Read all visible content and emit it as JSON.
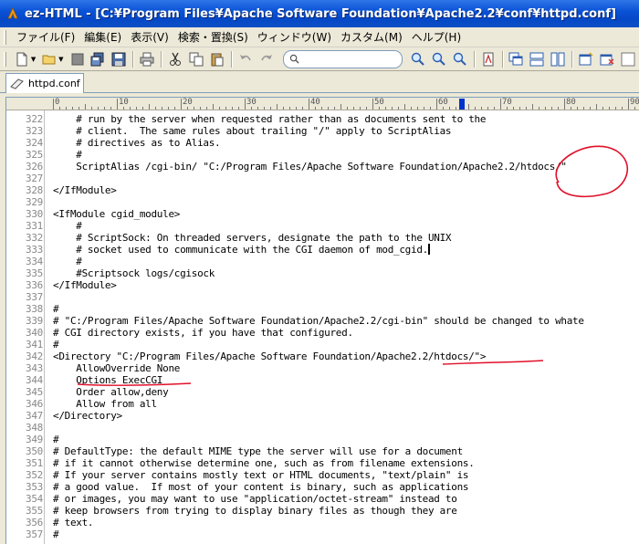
{
  "window": {
    "title": "ez-HTML - [C:¥Program Files¥Apache Software Foundation¥Apache2.2¥conf¥httpd.conf]"
  },
  "menu": [
    {
      "label": "ファイル(F)"
    },
    {
      "label": "編集(E)"
    },
    {
      "label": "表示(V)"
    },
    {
      "label": "検索・置換(S)"
    },
    {
      "label": "ウィンドウ(W)"
    },
    {
      "label": "カスタム(M)"
    },
    {
      "label": "ヘルプ(H)"
    }
  ],
  "toolbar": {
    "search_value": ""
  },
  "tabs": [
    {
      "label": "httpd.conf",
      "icon": "file-icon"
    }
  ],
  "ruler": {
    "labels": [
      "0",
      "10",
      "20",
      "30",
      "40",
      "50",
      "60",
      "70",
      "80",
      "90"
    ]
  },
  "editor": {
    "lines": [
      {
        "num": "322",
        "text": "    # run by the server when requested rather than as documents sent to the"
      },
      {
        "num": "323",
        "text": "    # client.  The same rules about trailing \"/\" apply to ScriptAlias"
      },
      {
        "num": "324",
        "text": "    # directives as to Alias."
      },
      {
        "num": "325",
        "text": "    #"
      },
      {
        "num": "326",
        "text": "    ScriptAlias /cgi-bin/ \"C:/Program Files/Apache Software Foundation/Apache2.2/htdocs/\""
      },
      {
        "num": "327",
        "text": ""
      },
      {
        "num": "328",
        "text": "</IfModule>"
      },
      {
        "num": "329",
        "text": ""
      },
      {
        "num": "330",
        "text": "<IfModule cgid_module>"
      },
      {
        "num": "331",
        "text": "    #"
      },
      {
        "num": "332",
        "text": "    # ScriptSock: On threaded servers, designate the path to the UNIX"
      },
      {
        "num": "333",
        "text": "    # socket used to communicate with the CGI daemon of mod_cgid."
      },
      {
        "num": "334",
        "text": "    #"
      },
      {
        "num": "335",
        "text": "    #Scriptsock logs/cgisock"
      },
      {
        "num": "336",
        "text": "</IfModule>"
      },
      {
        "num": "337",
        "text": ""
      },
      {
        "num": "338",
        "text": "#"
      },
      {
        "num": "339",
        "text": "# \"C:/Program Files/Apache Software Foundation/Apache2.2/cgi-bin\" should be changed to whate"
      },
      {
        "num": "340",
        "text": "# CGI directory exists, if you have that configured."
      },
      {
        "num": "341",
        "text": "#"
      },
      {
        "num": "342",
        "text": "<Directory \"C:/Program Files/Apache Software Foundation/Apache2.2/htdocs/\">"
      },
      {
        "num": "343",
        "text": "    AllowOverride None"
      },
      {
        "num": "344",
        "text": "    Options ExecCGI"
      },
      {
        "num": "345",
        "text": "    Order allow,deny"
      },
      {
        "num": "346",
        "text": "    Allow from all"
      },
      {
        "num": "347",
        "text": "</Directory>"
      },
      {
        "num": "348",
        "text": ""
      },
      {
        "num": "349",
        "text": "#"
      },
      {
        "num": "350",
        "text": "# DefaultType: the default MIME type the server will use for a document"
      },
      {
        "num": "351",
        "text": "# if it cannot otherwise determine one, such as from filename extensions."
      },
      {
        "num": "352",
        "text": "# If your server contains mostly text or HTML documents, \"text/plain\" is"
      },
      {
        "num": "353",
        "text": "# a good value.  If most of your content is binary, such as applications"
      },
      {
        "num": "354",
        "text": "# or images, you may want to use \"application/octet-stream\" instead to"
      },
      {
        "num": "355",
        "text": "# keep browsers from trying to display binary files as though they are"
      },
      {
        "num": "356",
        "text": "# text."
      },
      {
        "num": "357",
        "text": "#"
      }
    ]
  },
  "colors": {
    "annotation": "#e0102a",
    "titlebar": "#0a53d6"
  }
}
